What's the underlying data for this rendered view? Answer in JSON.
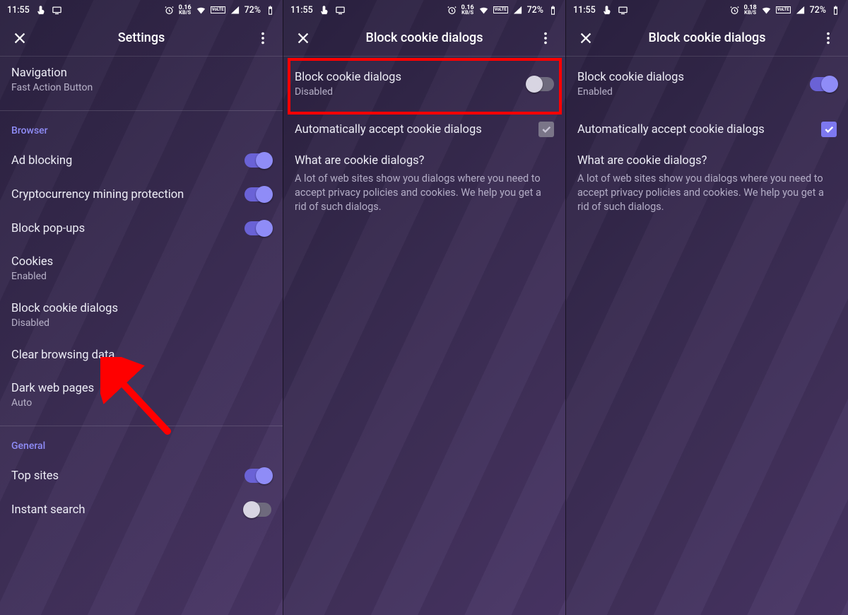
{
  "statusbar": {
    "time": "11:55",
    "kbs_a": "0.16",
    "kbs_b": "0.16",
    "kbs_c": "0.18",
    "kbs_unit": "KB/S",
    "volte": "VoLTE",
    "battery": "72%"
  },
  "pane1": {
    "title": "Settings",
    "nav": {
      "label": "Navigation",
      "sub": "Fast Action Button"
    },
    "section_browser": "Browser",
    "items": {
      "ad_blocking": "Ad blocking",
      "crypto": "Cryptocurrency mining protection",
      "popups": "Block pop-ups",
      "cookies": "Cookies",
      "cookies_sub": "Enabled",
      "block_cookie": "Block cookie dialogs",
      "block_cookie_sub": "Disabled",
      "clear": "Clear browsing data",
      "dark": "Dark web pages",
      "dark_sub": "Auto"
    },
    "section_general": "General",
    "general": {
      "top_sites": "Top sites",
      "instant_search": "Instant search"
    }
  },
  "pane2": {
    "title": "Block cookie dialogs",
    "main": {
      "label": "Block cookie dialogs",
      "sub": "Disabled"
    },
    "auto_accept": "Automatically accept cookie dialogs",
    "info_title": "What are cookie dialogs?",
    "info_desc": "A lot of web sites show you dialogs where you need to accept privacy policies and cookies. We help you get a rid of such dialogs."
  },
  "pane3": {
    "title": "Block cookie dialogs",
    "main": {
      "label": "Block cookie dialogs",
      "sub": "Enabled"
    },
    "auto_accept": "Automatically accept cookie dialogs",
    "info_title": "What are cookie dialogs?",
    "info_desc": "A lot of web sites show you dialogs where you need to accept privacy policies and cookies. We help you get a rid of such dialogs."
  }
}
